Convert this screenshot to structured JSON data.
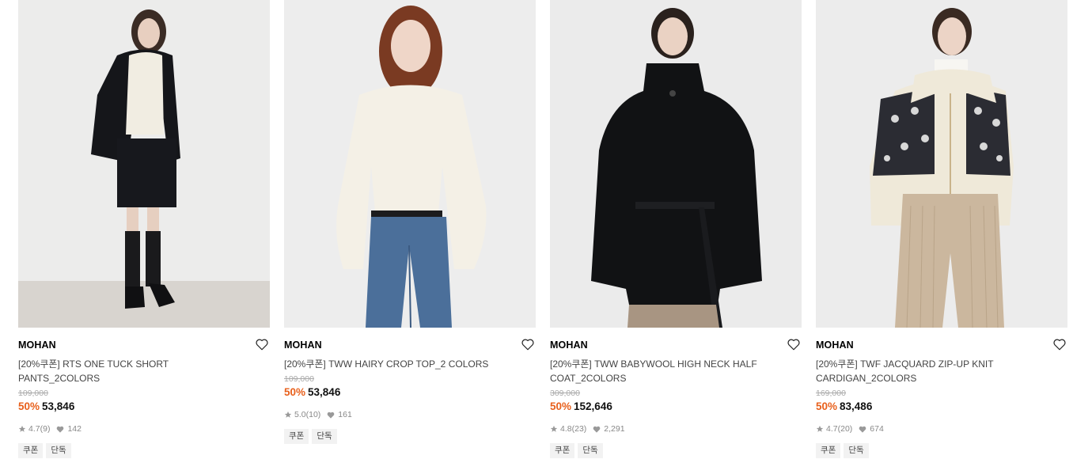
{
  "products": [
    {
      "brand": "MOHAN",
      "name": "[20%쿠폰] RTS ONE TUCK SHORT PANTS_2COLORS",
      "original_price": "109,000",
      "discount": "50%",
      "price": "53,846",
      "rating": "4.7",
      "reviews": "(9)",
      "likes": "142",
      "badges": [
        "쿠폰",
        "단독"
      ],
      "image": "model in black blazer, cream knit, black shorts"
    },
    {
      "brand": "MOHAN",
      "name": "[20%쿠폰] TWW HAIRY CROP TOP_2 COLORS",
      "original_price": "109,000",
      "discount": "50%",
      "price": "53,846",
      "rating": "5.0",
      "reviews": "(10)",
      "likes": "161",
      "badges": [
        "쿠폰",
        "단독"
      ],
      "image": "model in cream hairy crop top and blue jeans"
    },
    {
      "brand": "MOHAN",
      "name": "[20%쿠폰] TWW BABYWOOL HIGH NECK HALF COAT_2COLORS",
      "original_price": "309,000",
      "discount": "50%",
      "price": "152,646",
      "rating": "4.8",
      "reviews": "(23)",
      "likes": "2,291",
      "badges": [
        "쿠폰",
        "단독"
      ],
      "image": "model in black high neck belted half coat"
    },
    {
      "brand": "MOHAN",
      "name": "[20%쿠폰] TWF JACQUARD ZIP-UP KNIT CARDIGAN_2COLORS",
      "original_price": "169,000",
      "discount": "50%",
      "price": "83,486",
      "rating": "4.7",
      "reviews": "(20)",
      "likes": "674",
      "badges": [
        "쿠폰",
        "단독"
      ],
      "image": "model in jacquard zip-up knit cardigan and beige corduroy pants"
    }
  ],
  "colors": {
    "discount": "#e8601c",
    "original_price": "#aaaaaa",
    "badge_bg": "#f2f2f2",
    "meta_text": "#888888"
  },
  "icons": [
    "heart-outline-icon",
    "star-icon",
    "heart-filled-icon"
  ]
}
